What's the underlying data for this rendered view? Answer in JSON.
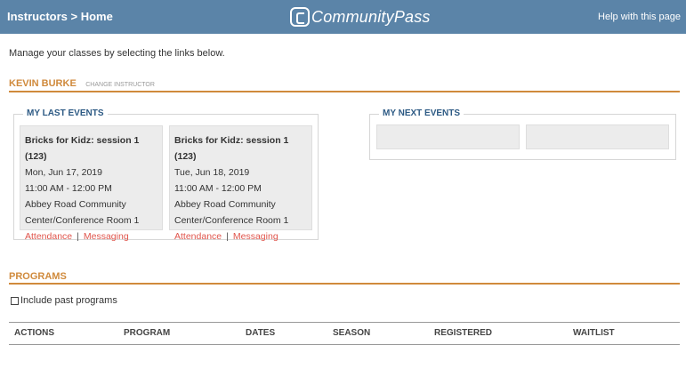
{
  "header": {
    "breadcrumb": "Instructors > Home",
    "logo_text": "CommunityPass",
    "help_link": "Help with this page"
  },
  "intro": "Manage your classes by selecting the links below.",
  "instructor": {
    "name": "KEVIN BURKE",
    "change_label": "CHANGE INSTRUCTOR"
  },
  "last_events": {
    "title": "MY LAST EVENTS",
    "events": [
      {
        "title": "Bricks for Kidz: session 1 (123)",
        "date": "Mon, Jun 17, 2019",
        "time": "11:00 AM - 12:00 PM",
        "location_line1": "Abbey Road Community",
        "location_line2": "Center/Conference Room 1",
        "attendance": "Attendance",
        "separator": "|",
        "messaging": "Messaging"
      },
      {
        "title": "Bricks for Kidz: session 1 (123)",
        "date": "Tue, Jun 18, 2019",
        "time": "11:00 AM - 12:00 PM",
        "location_line1": "Abbey Road Community",
        "location_line2": "Center/Conference Room 1",
        "attendance": "Attendance",
        "separator": "|",
        "messaging": "Messaging"
      }
    ]
  },
  "next_events": {
    "title": "MY NEXT EVENTS"
  },
  "programs": {
    "title": "PROGRAMS",
    "include_past": "Include past programs",
    "include_past_checked": false,
    "columns": [
      "ACTIONS",
      "PROGRAM",
      "DATES",
      "SEASON",
      "REGISTERED",
      "WAITLIST"
    ]
  },
  "colors": {
    "header_bg": "#5b84a8",
    "accent_orange": "#d08a3c",
    "section_blue": "#2d5a84",
    "link_red": "#e0554c"
  }
}
